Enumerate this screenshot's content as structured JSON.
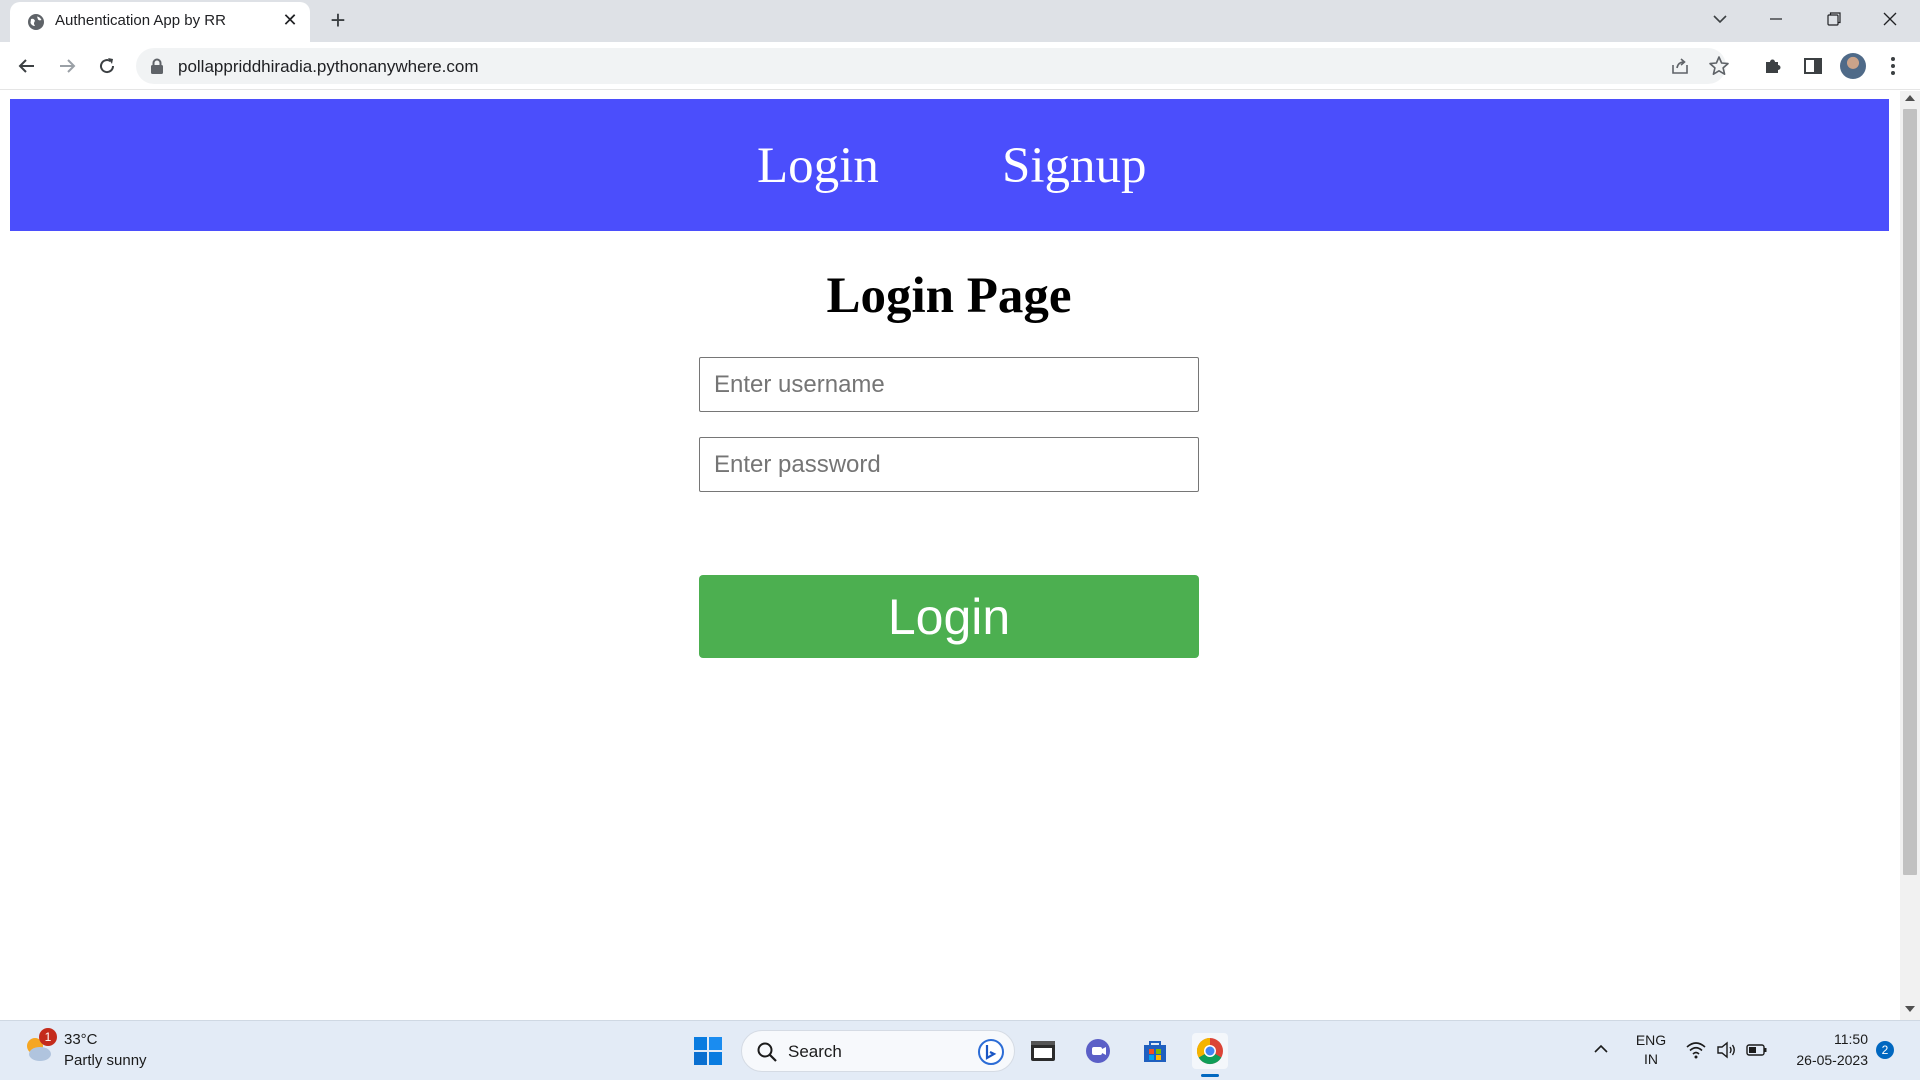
{
  "browser": {
    "tab_title": "Authentication App by RR",
    "tab_close": "✕",
    "new_tab": "+",
    "url": "pollappriddhiradia.pythonanywhere.com"
  },
  "site": {
    "nav": {
      "login": "Login",
      "signup": "Signup"
    },
    "title": "Login Page",
    "username_placeholder": "Enter username",
    "password_placeholder": "Enter password",
    "login_button": "Login",
    "colors": {
      "nav_bg": "#4b4efc",
      "button_bg": "#4caf50"
    }
  },
  "taskbar": {
    "weather_badge": "1",
    "temperature": "33°C",
    "weather": "Partly sunny",
    "search_label": "Search",
    "lang_line1": "ENG",
    "lang_line2": "IN",
    "time": "11:50",
    "date": "26-05-2023",
    "notification_count": "2"
  }
}
